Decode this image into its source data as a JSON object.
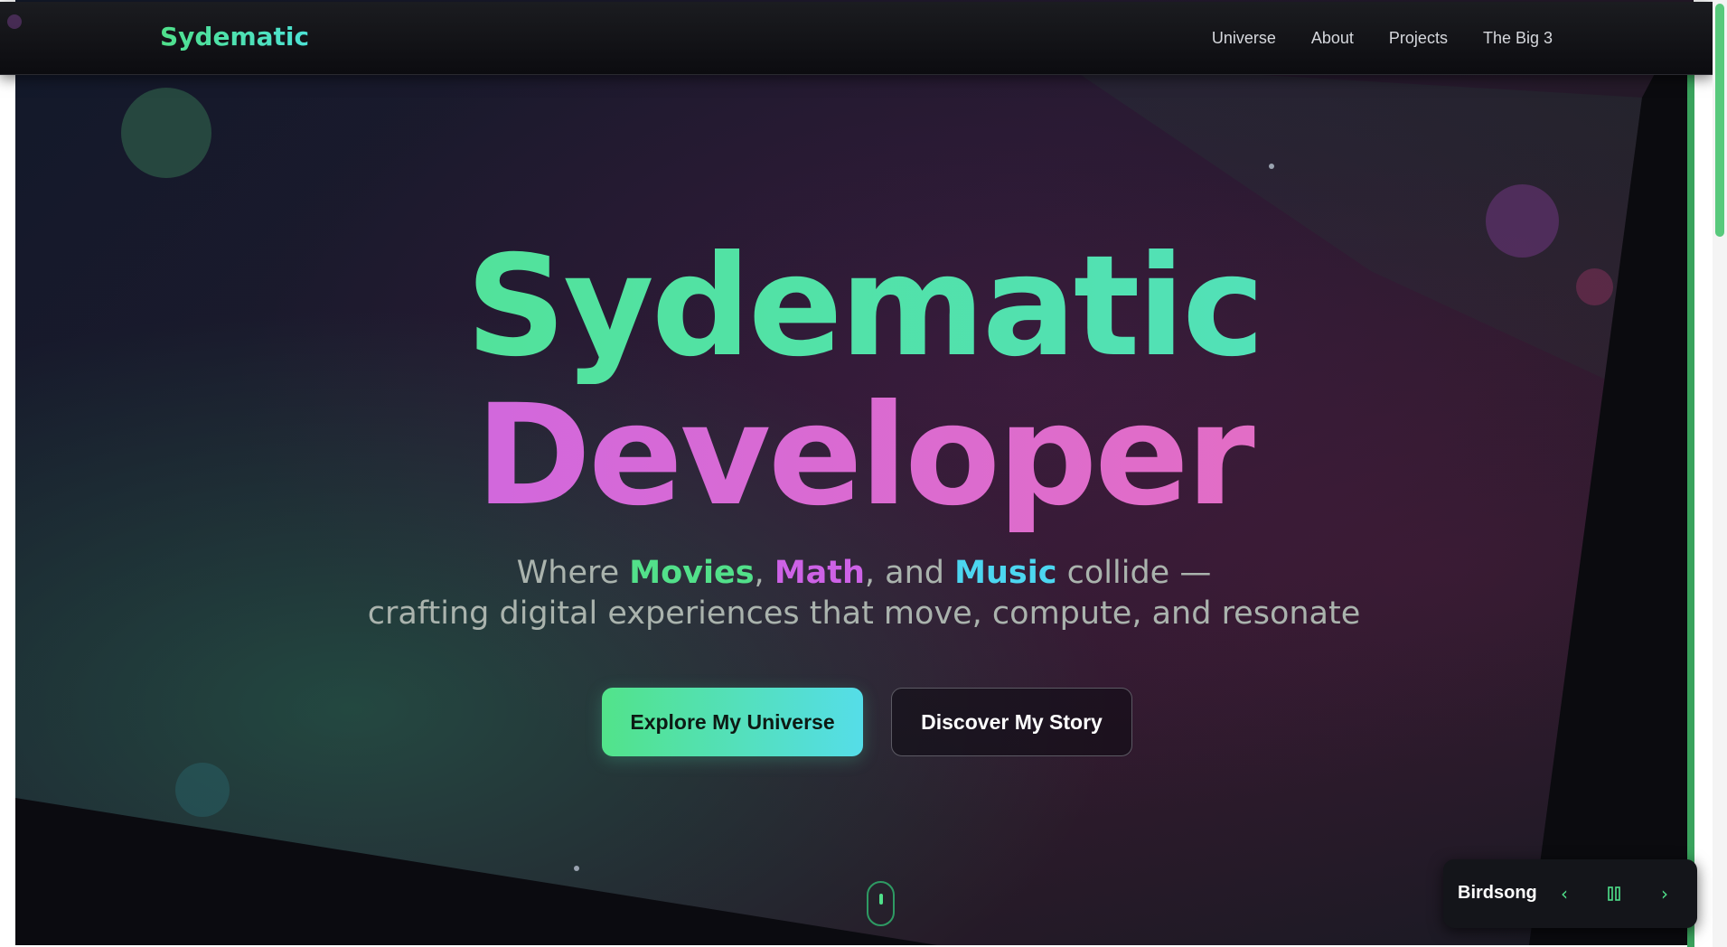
{
  "nav": {
    "logo": "Sydematic",
    "links": [
      "Universe",
      "About",
      "Projects",
      "The Big 3"
    ]
  },
  "hero": {
    "headline_1": "Sydematic",
    "headline_2": "Developer",
    "tagline": {
      "pre": "Where ",
      "kw1": "Movies",
      "sep1": ", ",
      "kw2": "Math",
      "sep2": ", and ",
      "kw3": "Music",
      "post": " collide —",
      "line2": "crafting digital experiences that move, compute, and resonate"
    },
    "cta_primary": "Explore My Universe",
    "cta_secondary": "Discover My Story"
  },
  "player": {
    "track": "Birdsong",
    "prev_icon": "chevron-left-icon",
    "pause_icon": "pause-icon",
    "next_icon": "chevron-right-icon",
    "prev_glyph": "‹",
    "pause_glyph": "❚❚",
    "next_glyph": "›"
  },
  "colors": {
    "accent_green": "#52e38a",
    "accent_teal": "#4de2d6",
    "accent_purple": "#cd62e6",
    "accent_pink": "#ec70b8",
    "accent_cyan": "#4cd6f0"
  }
}
